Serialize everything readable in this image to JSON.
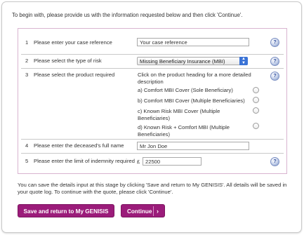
{
  "intro": "To begin with, please provide us with the information requested below and then click 'Continue'.",
  "help_glyph": "?",
  "rows": [
    {
      "num": "1",
      "label": "Please enter your case reference",
      "value": "Your case reference"
    },
    {
      "num": "2",
      "label": "Please select the type of risk",
      "value": "Missing Beneficiary Insurance (MBI)"
    },
    {
      "num": "3",
      "label": "Please select the product required",
      "instruction": "Click on the product heading for a more detailed description",
      "options": [
        "a) Comfort MBI Cover (Sole Beneficiary)",
        "b) Comfort MBI Cover (Multiple Beneficiaries)",
        "c) Known Risk MBI Cover (Multiple Beneficiaries)",
        "d) Known Risk + Comfort MBI (Multiple Beneficiaries)"
      ]
    },
    {
      "num": "4",
      "label": "Please enter the deceased's full name",
      "value": "Mr Jon Doe"
    },
    {
      "num": "5",
      "label": "Please enter the limit of indemnity required",
      "currency": "£",
      "value": "22500"
    }
  ],
  "save_note": "You can save the details input at this stage by clicking 'Save and return to My GENISIS'. All details will be saved in your quote log. To continue with the quote, please click 'Continue'.",
  "buttons": {
    "save": "Save and return to My GENISIS",
    "continue": "Continue",
    "continue_chevron": "›"
  },
  "colors": {
    "button": "#9b1c7a",
    "form_border": "#d9b4d0",
    "select_arrow": "#3b73d6"
  }
}
